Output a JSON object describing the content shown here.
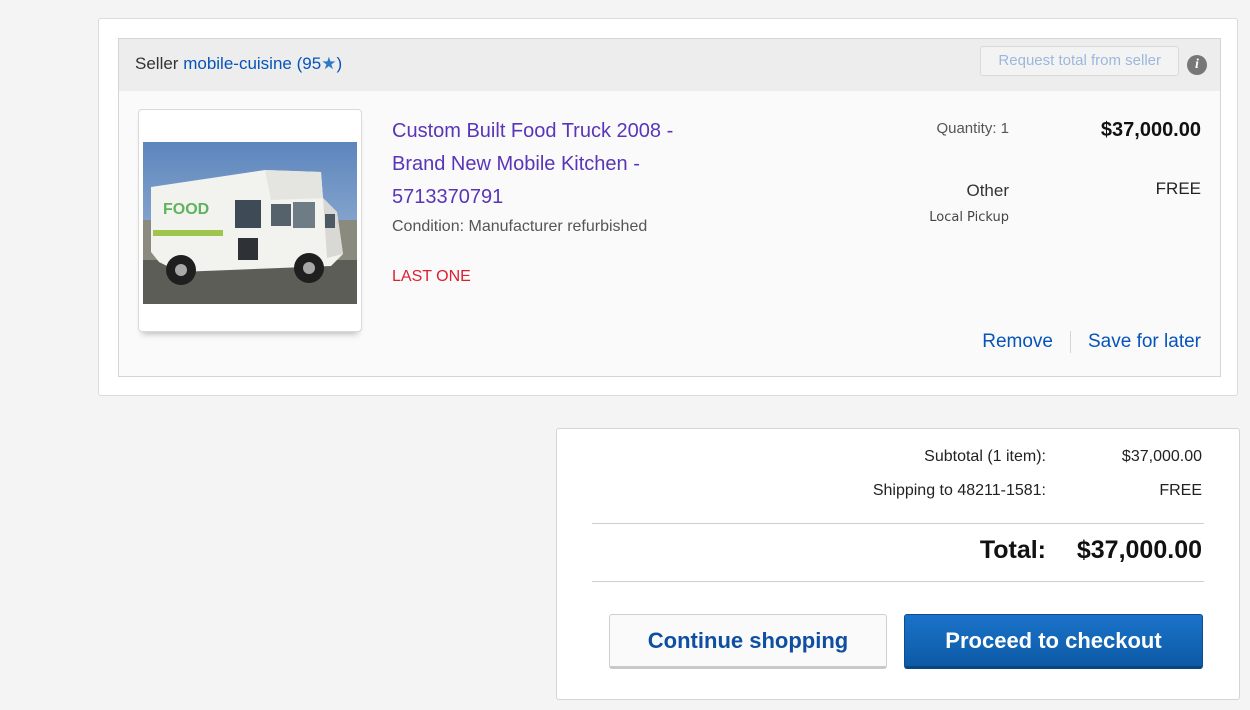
{
  "seller": {
    "prefix": "Seller",
    "name": "mobile-cuisine",
    "feedback_score": "95",
    "request_total_label": "Request total from seller",
    "info_icon_glyph": "i"
  },
  "item": {
    "title": "Custom Built Food Truck 2008 - Brand New Mobile Kitchen - 5713370791",
    "condition": "Condition:  Manufacturer refurbished",
    "stock_note": "LAST ONE",
    "quantity": "Quantity: 1",
    "price": "$37,000.00",
    "shipping_method": "Other",
    "shipping_type": "Local Pickup",
    "shipping_cost": "FREE",
    "image_icon": "food-truck-photo"
  },
  "actions": {
    "remove_label": "Remove",
    "save_label": "Save for later"
  },
  "summary": {
    "subtotal_label": "Subtotal (1 item):",
    "subtotal_value": "$37,000.00",
    "shipping_label": "Shipping to 48211-1581:",
    "shipping_value": "FREE",
    "total_label": "Total:",
    "total_value": "$37,000.00",
    "continue_label": "Continue shopping",
    "checkout_label": "Proceed to checkout"
  },
  "colors": {
    "link": "#0654ba",
    "item_title": "#5a35b8",
    "stock_alert": "#dd1e31",
    "checkout_button": "#1a6cbf"
  }
}
